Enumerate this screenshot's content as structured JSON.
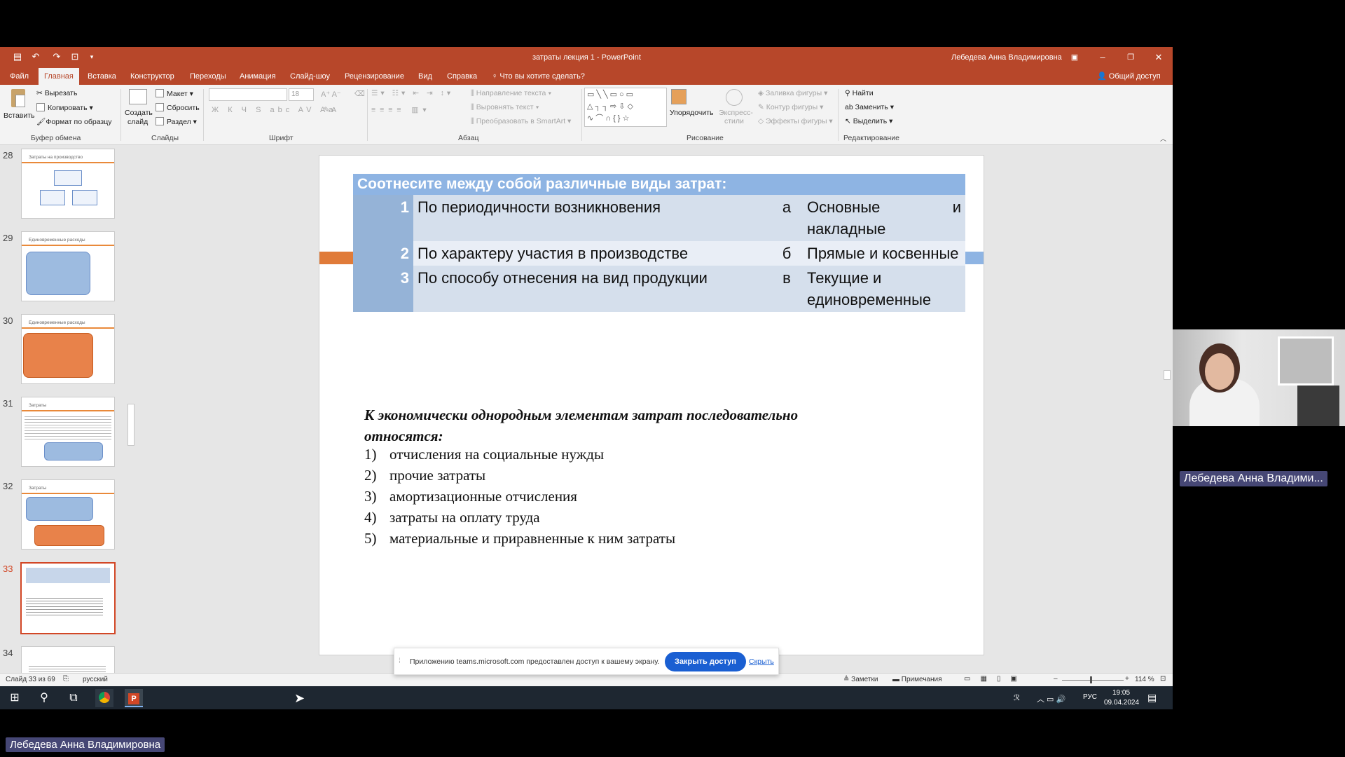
{
  "window": {
    "title": "затраты лекция 1 - PowerPoint",
    "user": "Лебедева Анна Владимировна"
  },
  "tabs": [
    {
      "label": "Файл"
    },
    {
      "label": "Главная"
    },
    {
      "label": "Вставка"
    },
    {
      "label": "Конструктор"
    },
    {
      "label": "Переходы"
    },
    {
      "label": "Анимация"
    },
    {
      "label": "Слайд-шоу"
    },
    {
      "label": "Рецензирование"
    },
    {
      "label": "Вид"
    },
    {
      "label": "Справка"
    },
    {
      "label": "Что вы хотите сделать?"
    }
  ],
  "share_label": "Общий доступ",
  "ribbon": {
    "paste": "Вставить",
    "cut": "Вырезать",
    "copy": "Копировать",
    "format_painter": "Формат по образцу",
    "clipboard_group": "Буфер обмена",
    "new_slide_line1": "Создать",
    "new_slide_line2": "слайд",
    "layout": "Макет",
    "reset": "Сбросить",
    "section": "Раздел",
    "slides_group": "Слайды",
    "font_size": "18",
    "font_group": "Шрифт",
    "text_direction": "Направление текста",
    "align_text": "Выровнять текст",
    "smartart": "Преобразовать в SmartArt",
    "paragraph_group": "Абзац",
    "arrange": "Упорядочить",
    "quick_styles_line1": "Экспресс-",
    "quick_styles_line2": "стили",
    "shape_fill": "Заливка фигуры",
    "shape_outline": "Контур фигуры",
    "shape_effects": "Эффекты фигуры",
    "drawing_group": "Рисование",
    "find": "Найти",
    "replace": "Заменить",
    "select": "Выделить",
    "editing_group": "Редактирование"
  },
  "thumbnails": [
    {
      "num": "28",
      "title": "Затраты на производство"
    },
    {
      "num": "29",
      "title": "Единовременные расходы"
    },
    {
      "num": "30",
      "title": "Единовременные расходы"
    },
    {
      "num": "31",
      "title": "Затраты"
    },
    {
      "num": "32",
      "title": "Затраты"
    },
    {
      "num": "33",
      "title": ""
    },
    {
      "num": "34",
      "title": ""
    }
  ],
  "slide": {
    "table_header": "Соотнесите между собой различные виды затрат:",
    "rows": [
      {
        "n": "1",
        "left": "По периодичности возникновения",
        "letter": "а",
        "right": "Основные и накладные"
      },
      {
        "n": "2",
        "left": "По характеру участия в производстве",
        "letter": "б",
        "right": "Прямые и косвенные"
      },
      {
        "n": "3",
        "left": "По способу отнесения на вид продукции",
        "letter": "в",
        "right": "Текущие и единовременные"
      }
    ],
    "question": "К экономически однородным элементам затрат последовательно относятся:",
    "options": [
      {
        "num": "1)",
        "text": "отчисления на социальные нужды"
      },
      {
        "num": "2)",
        "text": "прочие затраты"
      },
      {
        "num": "3)",
        "text": "амортизационные отчисления"
      },
      {
        "num": "4)",
        "text": "затраты на оплату труда"
      },
      {
        "num": "5)",
        "text": "материальные и приравненные к ним затраты"
      }
    ]
  },
  "share_banner": {
    "message": "Приложению teams.microsoft.com предоставлен доступ к вашему экрану.",
    "stop_button": "Закрыть доступ",
    "hide_link": "Скрыть"
  },
  "statusbar": {
    "slide_info": "Слайд 33 из 69",
    "language": "русский",
    "notes": "Заметки",
    "comments": "Примечания",
    "zoom": "114 %"
  },
  "taskbar": {
    "lang": "РУС",
    "time": "19:05",
    "date": "09.04.2024"
  },
  "webcam": {
    "name": "Лебедева Анна Владими..."
  },
  "meeting_presenter": "Лебедева Анна Владимировна",
  "colors": {
    "accent": "#b7472a",
    "table_header": "#8eb4e3",
    "teams_chip": "#464775",
    "teams_button": "#1a5fd2"
  }
}
